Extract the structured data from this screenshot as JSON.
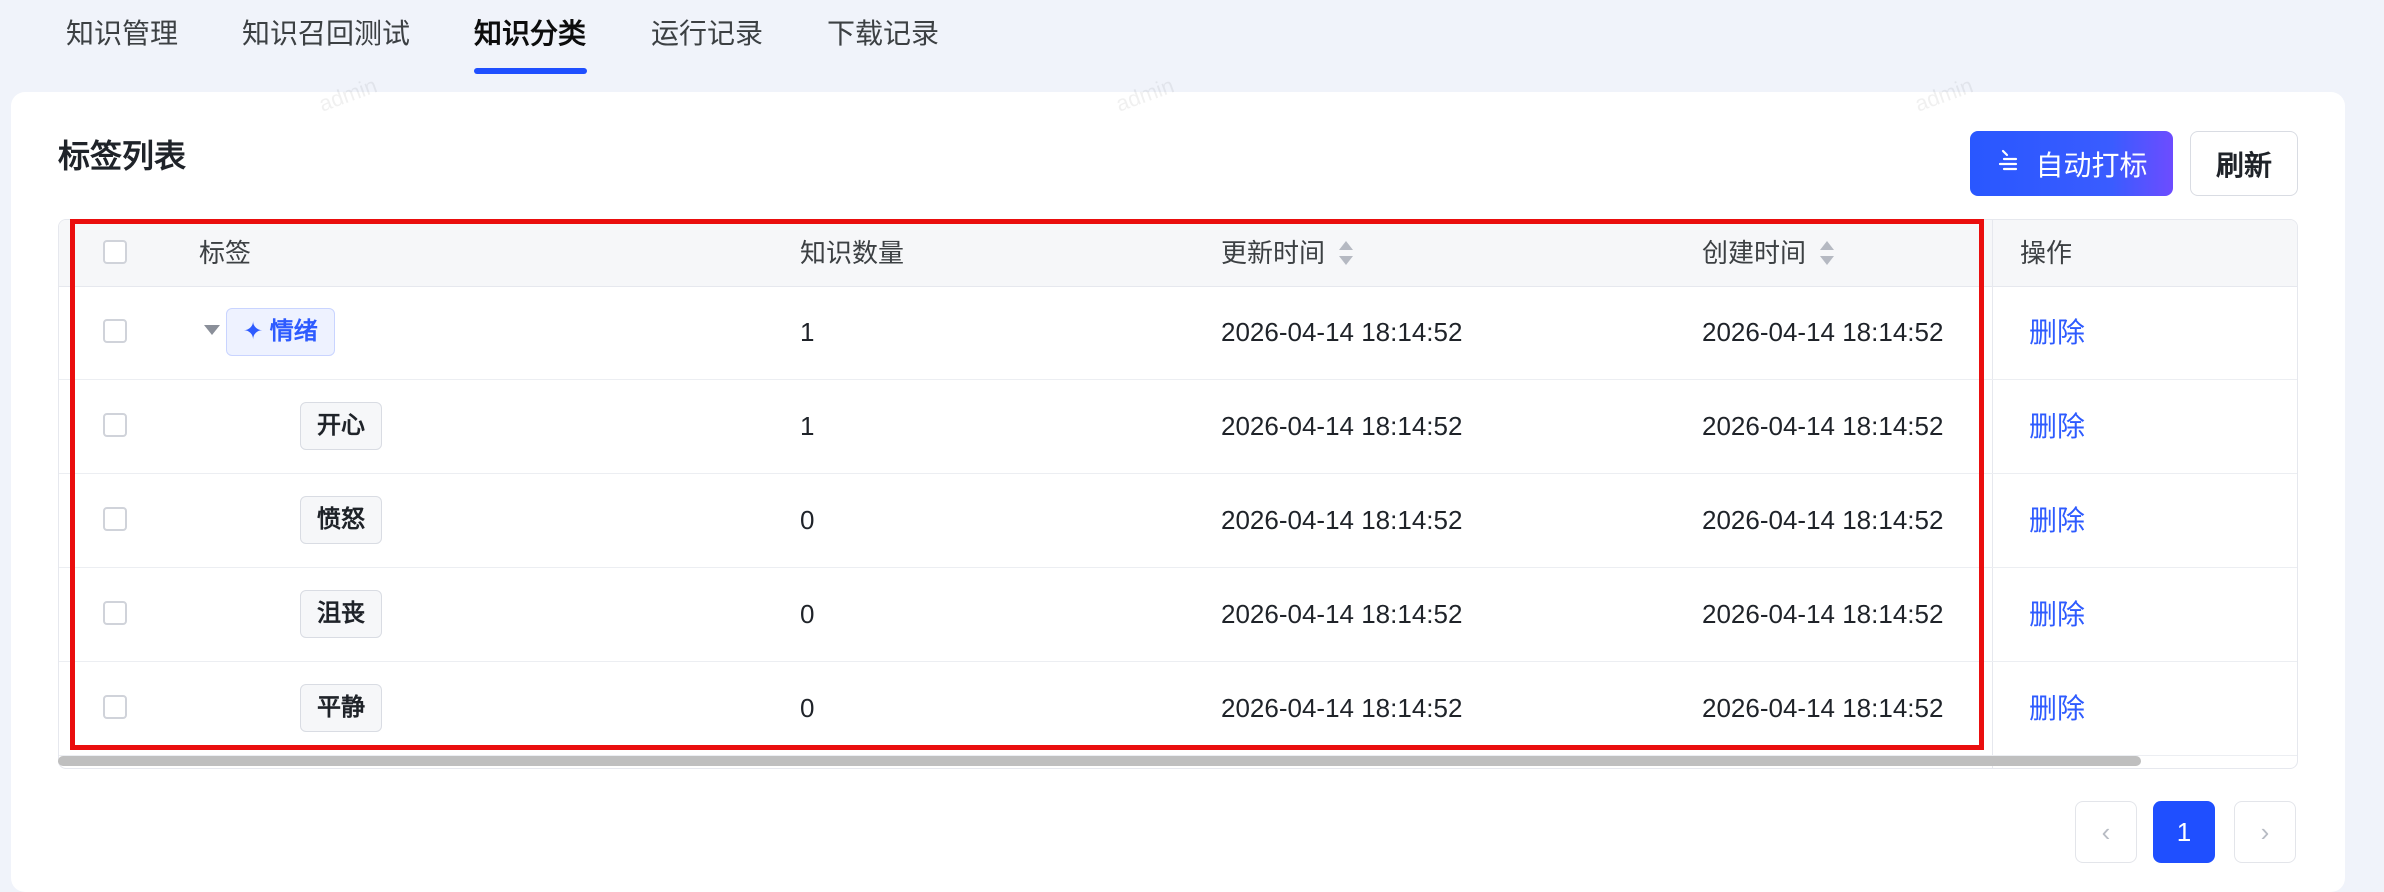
{
  "tabs": [
    {
      "label": "知识管理"
    },
    {
      "label": "知识召回测试"
    },
    {
      "label": "知识分类"
    },
    {
      "label": "运行记录"
    },
    {
      "label": "下载记录"
    }
  ],
  "section": {
    "title": "标签列表",
    "auto_tag_button": "自动打标",
    "refresh_button": "刷新"
  },
  "watermark": "admin",
  "table": {
    "columns": {
      "tag": "标签",
      "count": "知识数量",
      "updated": "更新时间",
      "created": "创建时间",
      "actions": "操作"
    },
    "rows": [
      {
        "tag": "情绪",
        "count": "1",
        "updated": "2026-04-14 18:14:52",
        "created": "2026-04-14 18:14:52",
        "action": "删除"
      },
      {
        "tag": "开心",
        "count": "1",
        "updated": "2026-04-14 18:14:52",
        "created": "2026-04-14 18:14:52",
        "action": "删除"
      },
      {
        "tag": "愤怒",
        "count": "0",
        "updated": "2026-04-14 18:14:52",
        "created": "2026-04-14 18:14:52",
        "action": "删除"
      },
      {
        "tag": "沮丧",
        "count": "0",
        "updated": "2026-04-14 18:14:52",
        "created": "2026-04-14 18:14:52",
        "action": "删除"
      },
      {
        "tag": "平静",
        "count": "0",
        "updated": "2026-04-14 18:14:52",
        "created": "2026-04-14 18:14:52",
        "action": "删除"
      }
    ]
  },
  "pagination": {
    "prev_icon": "chevron-left-icon",
    "current_page": "1",
    "next_icon": "chevron-right-icon"
  },
  "colors": {
    "primary": "#2e5bff",
    "highlight": "#ea0e0e"
  }
}
